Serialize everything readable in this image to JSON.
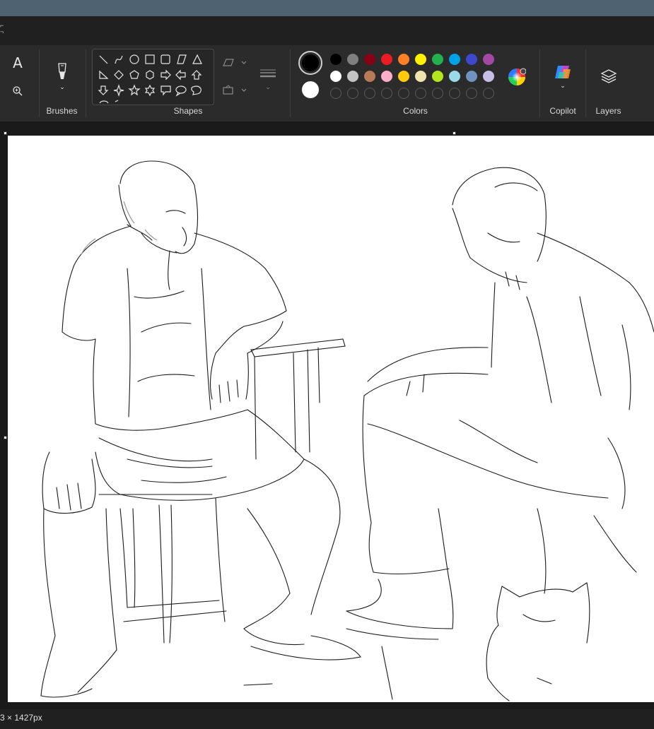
{
  "ribbon": {
    "groups": {
      "brushes": "Brushes",
      "shapes": "Shapes",
      "colors": "Colors",
      "copilot": "Copilot",
      "layers": "Layers"
    },
    "tools": {
      "text": "A"
    }
  },
  "colors": {
    "primary": "#000000",
    "secondary": "#ffffff",
    "palette_row1": [
      "#000000",
      "#7f7f7f",
      "#880015",
      "#ed1c24",
      "#ff7f27",
      "#fff200",
      "#22b14c",
      "#00a2e8",
      "#3f48cc",
      "#a349a4"
    ],
    "palette_row2": [
      "#ffffff",
      "#c3c3c3",
      "#b97a57",
      "#ffaec9",
      "#ffc90e",
      "#efe4b0",
      "#b5e61d",
      "#99d9ea",
      "#7092be",
      "#c8bfe7"
    ]
  },
  "status": {
    "dimensions": "3 × 1427px"
  }
}
